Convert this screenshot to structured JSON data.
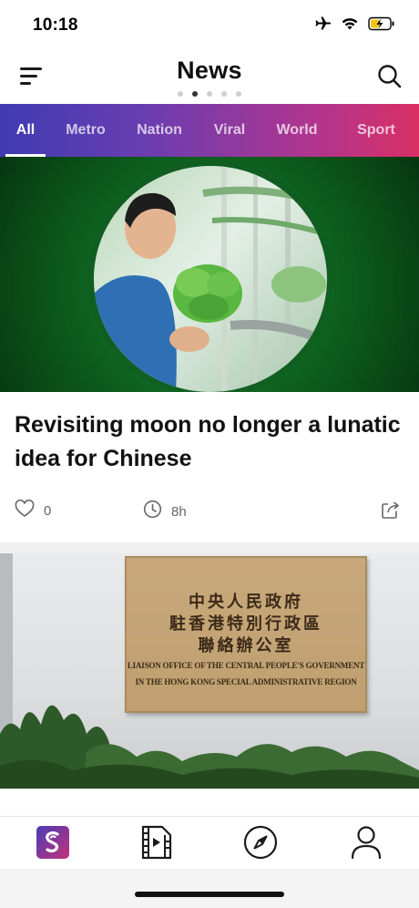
{
  "status_bar": {
    "time": "10:18",
    "icons": [
      "airplane-icon",
      "wifi-icon",
      "battery-charging-icon"
    ]
  },
  "header": {
    "title": "News",
    "menu_icon": "menu-icon",
    "search_icon": "search-icon",
    "page_dots": {
      "count": 5,
      "active_index": 1
    }
  },
  "tabs": [
    {
      "label": "All",
      "active": true
    },
    {
      "label": "Metro",
      "active": false
    },
    {
      "label": "Nation",
      "active": false
    },
    {
      "label": "Viral",
      "active": false
    },
    {
      "label": "World",
      "active": false
    },
    {
      "label": "Sport",
      "active": false
    }
  ],
  "articles": [
    {
      "title": "Revisiting moon no longer a lunatic idea for Chinese",
      "likes": "0",
      "age": "8h"
    },
    {
      "plaque_cn": [
        "中央人民政府",
        "駐香港特別行政區",
        "聯絡辦公室"
      ],
      "plaque_en": [
        "LIAISON OFFICE OF THE CENTRAL PEOPLE'S GOVERNMENT",
        "IN THE HONG KONG SPECIAL ADMINISTRATIVE REGION"
      ]
    }
  ],
  "bottom_nav": [
    {
      "name": "home",
      "icon": "brand-logo-icon",
      "active": true
    },
    {
      "name": "video",
      "icon": "video-icon",
      "active": false
    },
    {
      "name": "explore",
      "icon": "compass-icon",
      "active": false
    },
    {
      "name": "profile",
      "icon": "profile-icon",
      "active": false
    }
  ],
  "colors": {
    "tab_gradient_start": "#3f3bb3",
    "tab_gradient_end": "#d92f64",
    "brand_logo": "#6d2f9e"
  }
}
